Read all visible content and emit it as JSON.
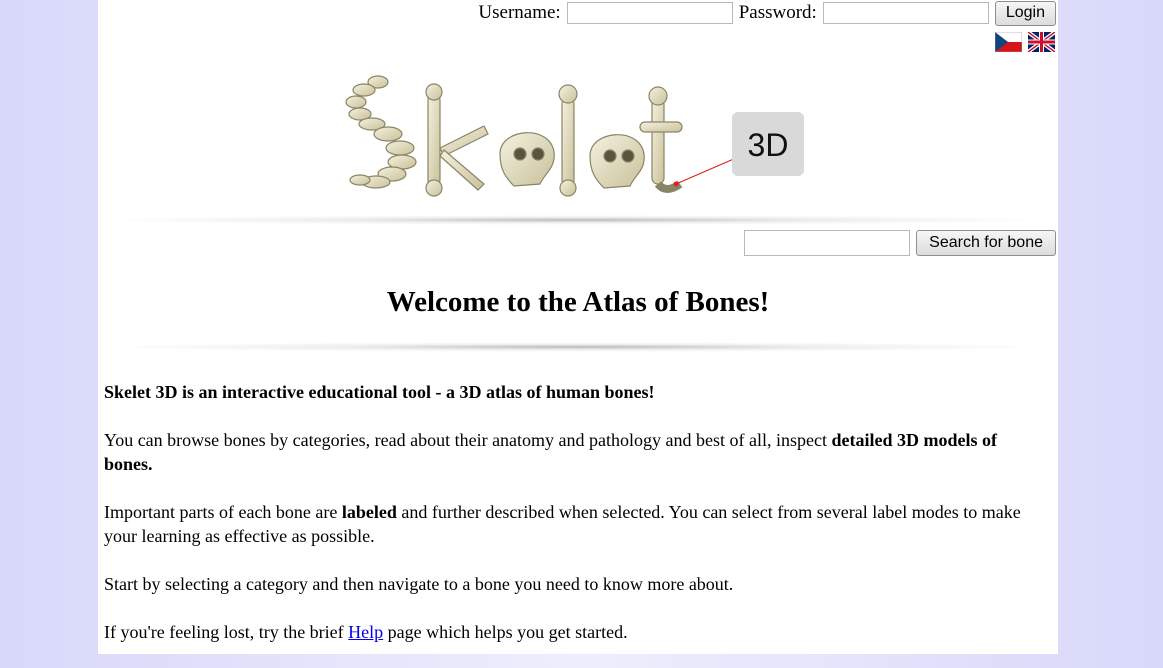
{
  "login": {
    "username_label": "Username:",
    "username_value": "",
    "password_label": "Password:",
    "password_value": "",
    "login_button": "Login"
  },
  "languages": [
    "czech-flag",
    "uk-flag"
  ],
  "logo": {
    "badge": "3D",
    "alt_icon": "skelet-logo"
  },
  "search": {
    "value": "",
    "button": "Search for bone"
  },
  "welcome": "Welcome to the Atlas of Bones!",
  "intro": {
    "p1_bold": "Skelet 3D is an interactive educational tool - a 3D atlas of human bones!",
    "p2_start": "You can browse bones by categories, read about their anatomy and pathology and best of all, inspect ",
    "p2_bold": "detailed 3D models of bones.",
    "p3_start": "Important parts of each bone are ",
    "p3_bold": "labeled",
    "p3_end": " and further described when selected. You can select from several label modes to make your learning as effective as possible.",
    "p4": "Start by selecting a category and then navigate to a bone you need to know more about.",
    "p5_start": "If you're feeling lost, try the brief ",
    "p5_link": "Help",
    "p5_end": " page which helps you get started."
  }
}
